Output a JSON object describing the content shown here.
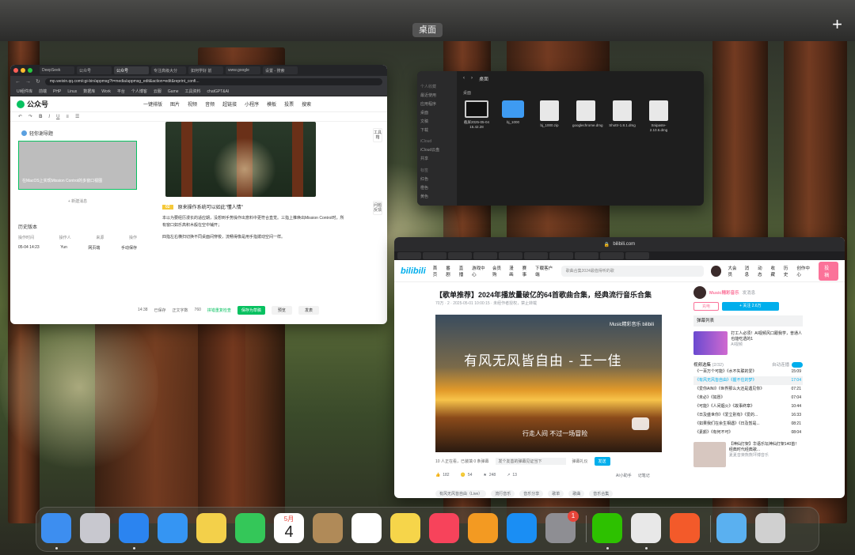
{
  "space": {
    "label": "桌面",
    "add_label": "+"
  },
  "wechat": {
    "tabs": [
      "DeepSeek",
      "公众号",
      "公众号",
      "专注高级大分",
      "如何学好 前",
      "www.google",
      "设置 - 搜索"
    ],
    "url": "mp.weixin.qq.com/cgi-bin/appmsg?t=media/appmsg_edit&action=edit&reprint_confi...",
    "bookmarks": [
      "UI组件库",
      "前端",
      "PHP",
      "Linux",
      "数据库",
      "Work",
      "平台",
      "个人博客",
      "云服",
      "Game",
      "工具资料",
      "chatGPT&AI"
    ],
    "logo": "公众号",
    "menu": [
      "一键排版",
      "图片",
      "视频",
      "音频",
      "超链接",
      "小程序",
      "模板",
      "投票",
      "搜索"
    ],
    "left_title": "轻你谢导题",
    "card_caption": "在MacOS上实现Mission Control的多窗口视图",
    "new_msg": "+ 新建消息",
    "history_title": "历史版本",
    "history_head": [
      "操作时间",
      "操作人",
      "来源",
      "操作"
    ],
    "history_row": [
      "05-04 14:23",
      "Yun",
      "网页端",
      "手动保存"
    ],
    "heading_tag": "02",
    "heading": "原来操作系统可以如此\"懂人情\"",
    "para1": "本以为要经历漫长的适应期，没想到手势操作出意料中更符合直觉。三指上推唤出Mission Control时，所有窗口如乐高积木般在空中铺开；",
    "para2": "四指左右横扫切换不同桌面间穿梭，流畅得像是用手指拨动空间一样。",
    "save_bar": {
      "time": "14:38",
      "saved": "已保存",
      "count_label": "正文字数",
      "count": "760",
      "check": "拼错重复检查",
      "save_draft": "保存为草稿",
      "preview": "预览",
      "publish": "发表"
    },
    "toolbox": "工具箱",
    "help": "问题反馈"
  },
  "finder": {
    "path": "桌面",
    "section": "桌面",
    "sidebar": [
      "个人收藏",
      "最近使用",
      "应用程序",
      "桌面",
      "文稿",
      "下载",
      "iCloud",
      "iCloud云盘",
      "共享",
      "标签",
      "红色",
      "橙色",
      "黄色"
    ],
    "files": [
      {
        "name": "截屏2025-05-04 15.42.28",
        "kind": "mon"
      },
      {
        "name": "bj_1000",
        "kind": "fold"
      },
      {
        "name": "bj_1000.zip",
        "kind": "doc"
      },
      {
        "name": "googlechrome.dmg",
        "kind": "doc"
      },
      {
        "name": "Shottr-1.8.1.dmg",
        "kind": "doc"
      },
      {
        "name": "Snipaste-2.10.6.dmg",
        "kind": "doc"
      }
    ]
  },
  "bilibili": {
    "domain": "bilibili.com",
    "logo": "bilibili",
    "nav": [
      "首页",
      "番剧",
      "直播",
      "游戏中心",
      "会员购",
      "漫画",
      "赛事",
      "下载客户端"
    ],
    "search_placeholder": "歌曲合集2024最值得听的歌",
    "user_nav": [
      "大会员",
      "消息",
      "动态",
      "收藏",
      "历史",
      "创作中心"
    ],
    "upload": "投稿",
    "title": "【歌单推荐】2024年播放量破亿的64首歌曲合集，经典流行音乐合集",
    "meta": "70万  ·  2  ·  2025-05-01 10:00:15  ·  未经作者授权，禁止转载",
    "video_text": "有风无风皆自由 - 王一佳",
    "video_sub": "行走人间 不过一场冒险",
    "video_mark": "Music精彩音乐 bilibili",
    "danmu_count": "10 人正在看，已装填 0 条弹幕",
    "danmu_placeholder": "发个友善的弹幕见证当下",
    "danmu_etiquette": "弹幕礼仪",
    "send": "发送",
    "actions": [
      {
        "icon": "like-icon",
        "label": "182"
      },
      {
        "icon": "coin-icon",
        "label": "54"
      },
      {
        "icon": "star-icon",
        "label": "248"
      },
      {
        "icon": "share-icon",
        "label": "13"
      }
    ],
    "ai": "AI小助手",
    "note": "记笔记",
    "tags": [
      "有风无风皆自由（Live）",
      "流行音乐",
      "音乐分享",
      "歌单",
      "歌曲",
      "音乐合集"
    ],
    "up_name": "Music精彩音乐",
    "up_mail": "发消息",
    "charge": "充电",
    "follow": "+ 关注 2.6万",
    "danmu_list": "弹幕列表",
    "ad_title": "打工人必须！AI视频风口跟我学，普通人也能吃透的1",
    "ad_sub": "AI视频",
    "playlist_title": "视频选集",
    "playlist_progress": "(2/32)",
    "autoplay": "自动连播",
    "playlist": [
      {
        "name": "《一百万个可能》《水不失联的爱》",
        "time": "15:09"
      },
      {
        "name": "《有风无风皆自由》《握不住的梦》",
        "time": "17:04"
      },
      {
        "name": "《爱你AINI》《世界那么大还是遇见你》",
        "time": "07:21"
      },
      {
        "name": "《未必》《如愿》",
        "time": "07:04"
      },
      {
        "name": "《可能》《人间烟火》《故事终章》",
        "time": "10:44"
      },
      {
        "name": "《日及盛世你》《爱立别有》《爱的...",
        "time": "16:33"
      },
      {
        "name": "《如果我们在余生相遇》《日及暂是...",
        "time": "08:21"
      },
      {
        "name": "《素颜》《有何不可》",
        "time": "08:04"
      }
    ],
    "rec_title": "【神仙打架】华语乐坛神仙打架140首！经典时代经典歌...",
    "rec_meta": "夏夏音楽熊熊坪博音乐"
  },
  "dock": {
    "apps": [
      {
        "name": "finder-app",
        "color": "#3d8ef0",
        "open": true
      },
      {
        "name": "launchpad-app",
        "color": "#c8c8cf",
        "open": false
      },
      {
        "name": "safari-app",
        "color": "#2b84f0",
        "open": true
      },
      {
        "name": "mail-app",
        "color": "#3595f3",
        "open": false
      },
      {
        "name": "photos-app",
        "color": "#f3d04a",
        "open": false
      },
      {
        "name": "facetime-app",
        "color": "#34c759",
        "open": false
      },
      {
        "name": "calendar-app",
        "color": "#ffffff",
        "open": false
      },
      {
        "name": "contacts-app",
        "color": "#b08a58",
        "open": false
      },
      {
        "name": "reminders-app",
        "color": "#ffffff",
        "open": false
      },
      {
        "name": "notes-app",
        "color": "#f6d54a",
        "open": false
      },
      {
        "name": "music-app",
        "color": "#f7435b",
        "open": false
      },
      {
        "name": "pages-app",
        "color": "#f39a22",
        "open": false
      },
      {
        "name": "appstore-app",
        "color": "#1a8ef4",
        "open": false
      },
      {
        "name": "settings-app",
        "color": "#8e8e93",
        "open": false
      },
      {
        "name": "wechat-app",
        "color": "#2dc100",
        "open": true
      },
      {
        "name": "chrome-app",
        "color": "#e8e8e8",
        "open": true
      },
      {
        "name": "sogou-app",
        "color": "#f35a2a",
        "open": false
      },
      {
        "name": "downloads-folder",
        "color": "#5ab0f0",
        "open": false
      },
      {
        "name": "trash",
        "color": "#d0d0d0",
        "open": false
      }
    ],
    "calendar_month": "5月",
    "calendar_day": "4",
    "settings_badge": "1"
  }
}
